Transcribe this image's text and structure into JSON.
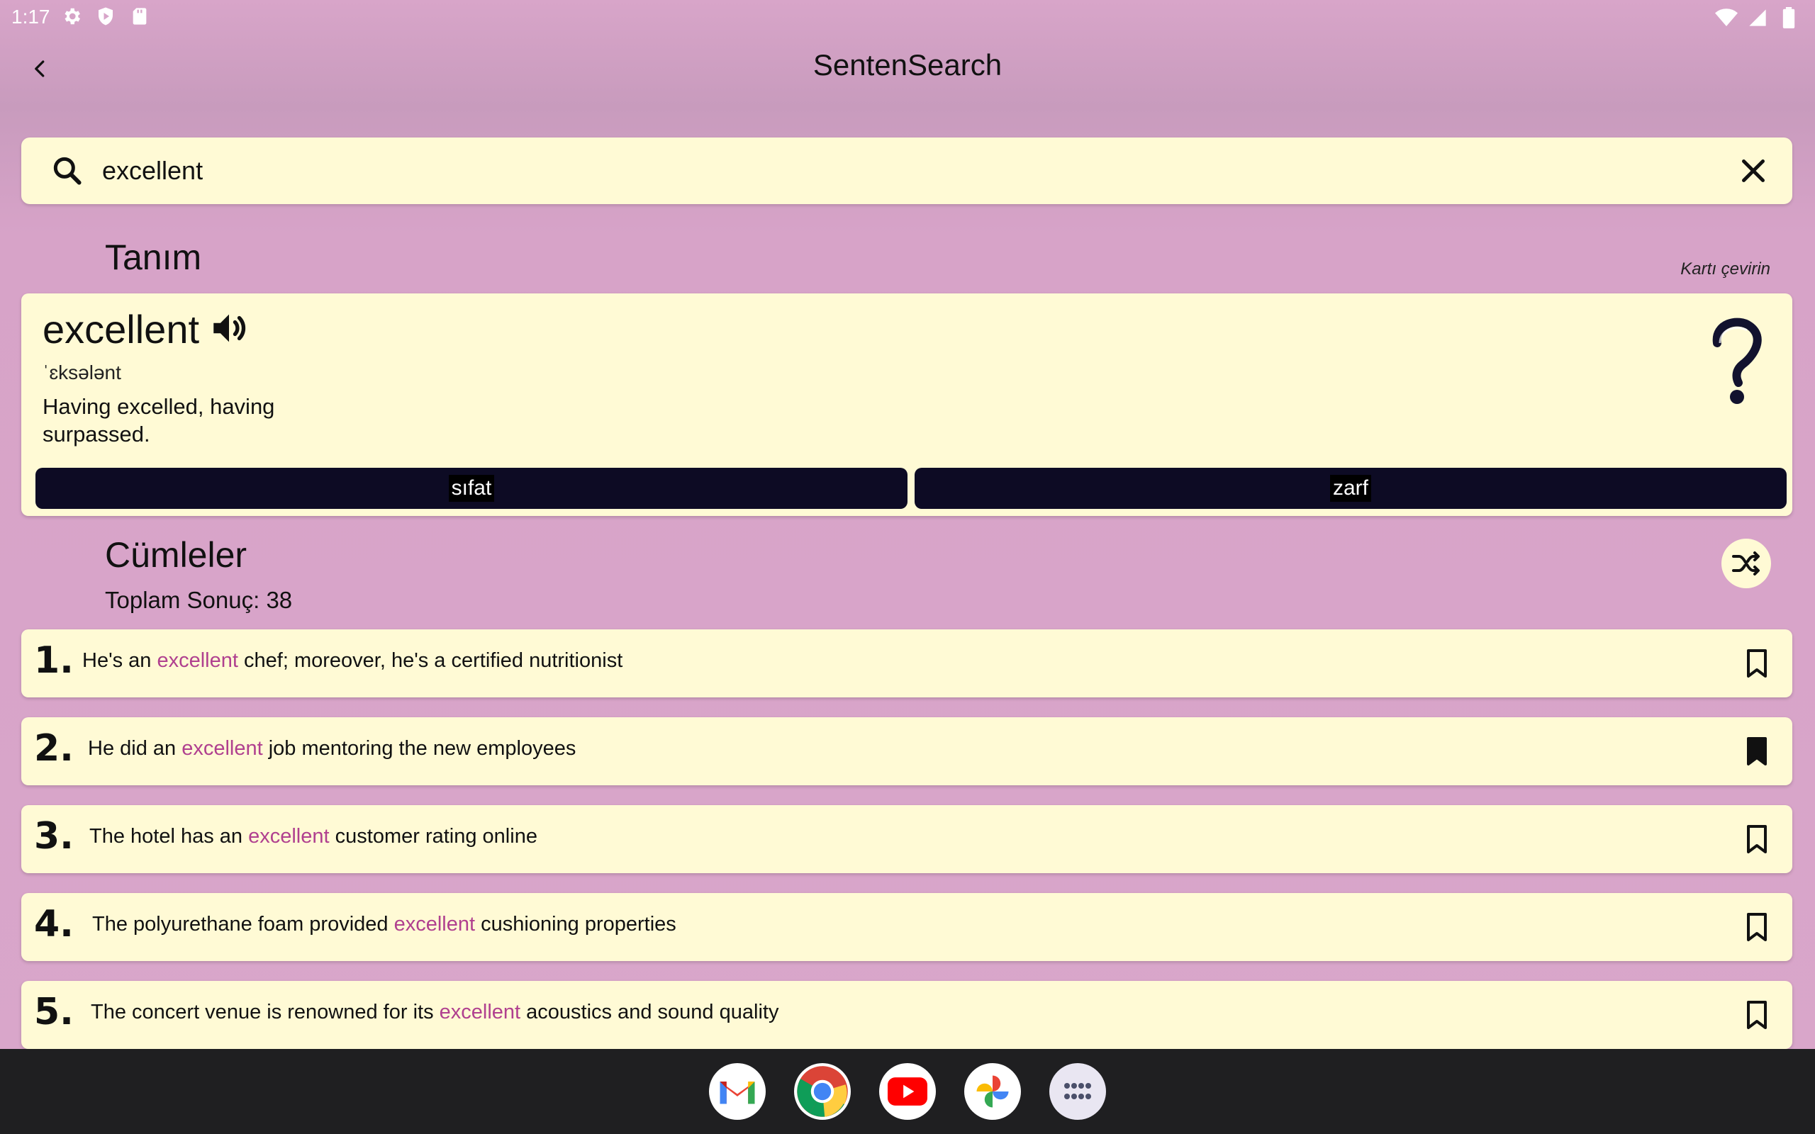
{
  "status_bar": {
    "time": "1:17",
    "left_icons": [
      "settings-icon",
      "shield-play-icon",
      "sd-card-icon"
    ],
    "right_icons": [
      "wifi-icon",
      "cellular-icon",
      "battery-icon"
    ]
  },
  "app_bar": {
    "title": "SentenSearch",
    "back_icon": "chevron-left-icon"
  },
  "search": {
    "value": "excellent",
    "placeholder": ""
  },
  "definition_section": {
    "title": "Tanım",
    "flip_label": "Kartı çevirin",
    "word": "excellent",
    "phonetic": "ˈɛksələnt",
    "definition": "Having excelled, having surpassed.",
    "parts_of_speech": [
      "sıfat",
      "zarf"
    ]
  },
  "sentences_section": {
    "title": "Cümleler",
    "total": "Toplam Sonuç: 38",
    "items": [
      {
        "number": "1.",
        "before": "He's an ",
        "highlight": "excellent",
        "after": " chef; moreover, he's a certified nutritionist",
        "bookmarked": false
      },
      {
        "number": "2.",
        "before": "He did an ",
        "highlight": "excellent",
        "after": " job mentoring the new employees",
        "bookmarked": true
      },
      {
        "number": "3.",
        "before": "The hotel has an ",
        "highlight": "excellent",
        "after": " customer rating online",
        "bookmarked": false
      },
      {
        "number": "4.",
        "before": "The polyurethane foam provided ",
        "highlight": "excellent",
        "after": " cushioning properties",
        "bookmarked": false
      },
      {
        "number": "5.",
        "before": "The concert venue is renowned for its ",
        "highlight": "excellent",
        "after": " acoustics and sound quality",
        "bookmarked": false
      }
    ]
  },
  "dock": {
    "apps": [
      "gmail-icon",
      "chrome-icon",
      "youtube-icon",
      "photos-icon",
      "app-drawer-icon"
    ]
  },
  "colors": {
    "background": "#d9a6ca",
    "card": "#fffad5",
    "highlight": "#b0408f",
    "pill": "#0d0b24",
    "taskbar": "#1f1f21"
  }
}
